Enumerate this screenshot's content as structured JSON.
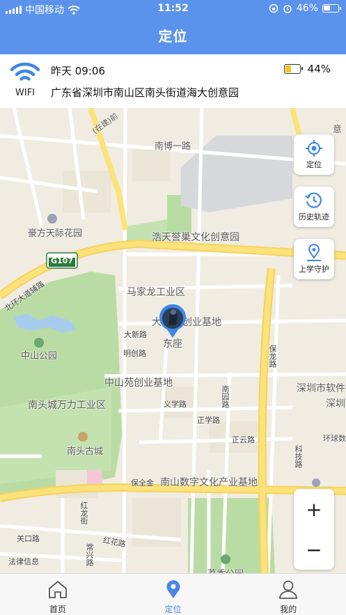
{
  "status_bar": {
    "carrier": "中国移动",
    "time": "11:52",
    "battery": "46%"
  },
  "header": {
    "title": "定位"
  },
  "info": {
    "connection": "WIFI",
    "time": "昨天 09:06",
    "address": "广东省深圳市南山区南头街道海大创意园",
    "battery_pct": "44%",
    "battery_level": 0.44,
    "battery_color": "#f5c518"
  },
  "map": {
    "labels": {
      "nanbo_road": "南博一路",
      "haofang": "豪方天际花园",
      "haotian": "浩天誉巢文化创意园",
      "g107": "G107",
      "beihuan": "北环大道辅路",
      "majialong": "马家龙工业区",
      "chuangye_base": "创业基地",
      "da_prefix": "大",
      "dazuo": "东座",
      "daxin_road": "大新路",
      "mingchuang_road": "明创路",
      "zhongshan_park": "中山公园",
      "zhongshanyuan": "中山苑创业基地",
      "nantou_wanli": "南头城万力工业区",
      "nantou_old": "南头古城",
      "yixue_road": "义学路",
      "zhengxue_road": "正学路",
      "zhengyun_road": "正云路",
      "shenzhen_software": "深圳市软件",
      "shen": "深圳",
      "huanqiu": "环球数",
      "baoquan": "保全金",
      "nanshan_digital": "南山数字文化产业基地",
      "guanko_road": "关口路",
      "hongcheng_road": "红花路",
      "falv": "法律信息",
      "lixiang_park": "荔香公园",
      "zaijian": "(在建)前",
      "yi": "意",
      "keji_road": "科技路",
      "baolong_road": "保龙路",
      "nanyuan_road": "南园路",
      "honglong_street": "红龙街",
      "changxing_road": "常兴路"
    }
  },
  "map_buttons": {
    "locate": "定位",
    "history": "历史轨迹",
    "school_guard": "上学守护",
    "zoom_in": "+",
    "zoom_out": "−"
  },
  "tabs": [
    {
      "label": "首页",
      "icon": "home-icon"
    },
    {
      "label": "定位",
      "icon": "location-pin-icon",
      "active": true
    },
    {
      "label": "我的",
      "icon": "user-icon"
    }
  ],
  "colors": {
    "primary": "#5b93ec",
    "tab_active": "#4a86e8",
    "map_background": "#f1ece2",
    "road_major": "#fbe27a",
    "park": "#b9dca4"
  }
}
